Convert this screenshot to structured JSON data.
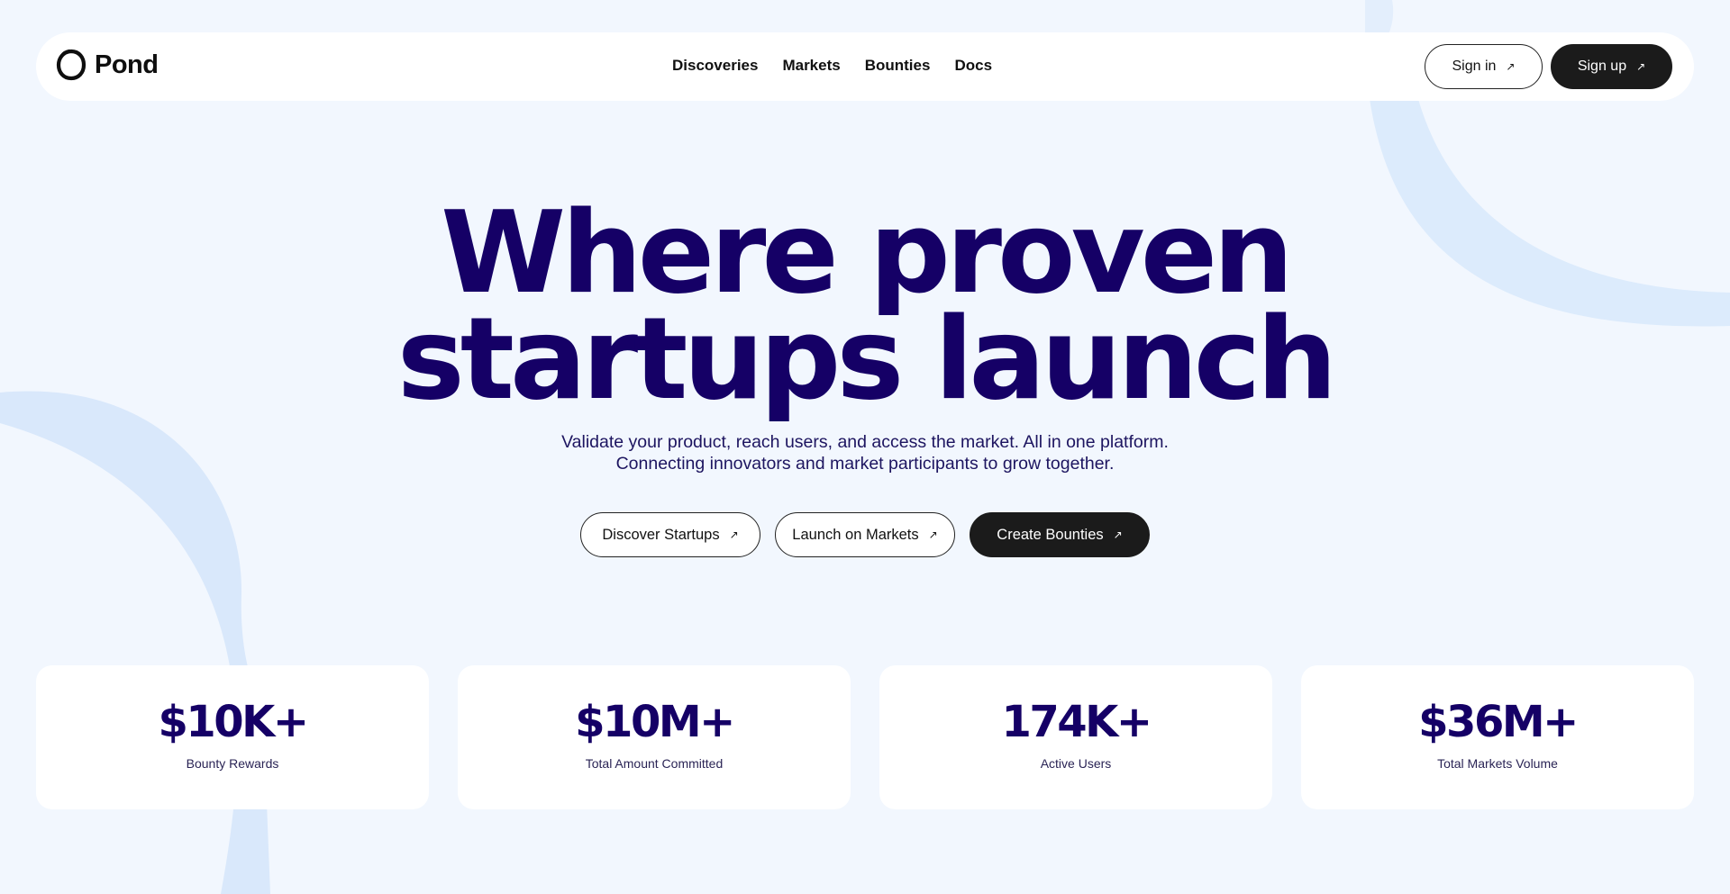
{
  "brand": {
    "name": "Pond",
    "icon": "pond-ring-icon"
  },
  "nav": {
    "links": [
      "Discoveries",
      "Markets",
      "Bounties",
      "Docs"
    ],
    "sign_in": "Sign in",
    "sign_up": "Sign up",
    "arrow": "↗"
  },
  "hero": {
    "title_line1": "Where proven",
    "title_line2": "startups launch",
    "subtitle_line1": "Validate your product, reach users, and access the market. All in one platform.",
    "subtitle_line2": "Connecting innovators and market participants to grow together."
  },
  "cta": {
    "discover": "Discover Startups",
    "launch": "Launch on Markets",
    "bounties": "Create Bounties"
  },
  "stats": [
    {
      "value": "$10K+",
      "label": "Bounty Rewards"
    },
    {
      "value": "$10M+",
      "label": "Total Amount Committed"
    },
    {
      "value": "174K+",
      "label": "Active Users"
    },
    {
      "value": "$36M+",
      "label": "Total Markets Volume"
    }
  ],
  "colors": {
    "background": "#f2f7fe",
    "headline": "#150066",
    "dark_button": "#1b1b1b",
    "decor": "#d9e8fb"
  }
}
